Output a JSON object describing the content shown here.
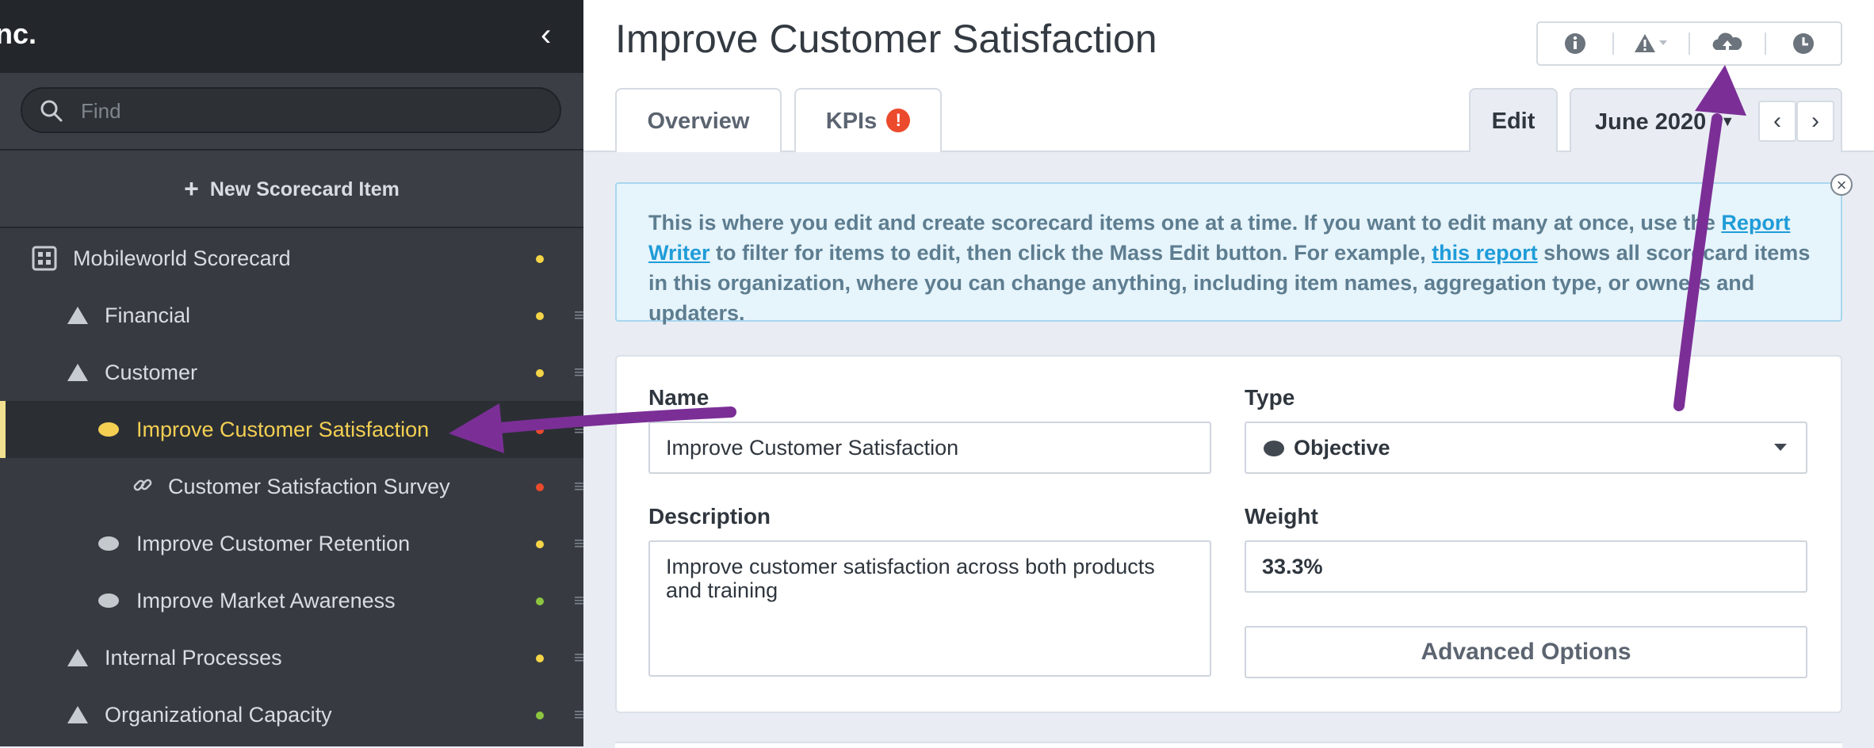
{
  "sidebar": {
    "org_title": "nc.",
    "search_placeholder": "Find",
    "new_item_label": "New Scorecard Item",
    "items": [
      {
        "label": "Mobileworld Scorecard",
        "icon": "scorecard-icon",
        "status_color": "#f5d547"
      },
      {
        "label": "Financial",
        "icon": "triangle-icon",
        "status_color": "#f5d547"
      },
      {
        "label": "Customer",
        "icon": "triangle-icon",
        "status_color": "#f5d547"
      },
      {
        "label": "Improve Customer Satisfaction",
        "icon": "objective-icon",
        "status_color": "#ec4a2c",
        "active": true
      },
      {
        "label": "Customer Satisfaction Survey",
        "icon": "link-icon",
        "status_color": "#ec4a2c"
      },
      {
        "label": "Improve Customer Retention",
        "icon": "objective-icon",
        "status_color": "#f5d547"
      },
      {
        "label": "Improve Market Awareness",
        "icon": "objective-icon",
        "status_color": "#8cc63f"
      },
      {
        "label": "Internal Processes",
        "icon": "triangle-icon",
        "status_color": "#f5d547"
      },
      {
        "label": "Organizational Capacity",
        "icon": "triangle-icon",
        "status_color": "#8cc63f"
      }
    ]
  },
  "header": {
    "title": "Improve Customer Satisfaction",
    "icons": [
      "info-icon",
      "warning-icon",
      "cloud-upload-icon",
      "clock-icon"
    ]
  },
  "tabs": {
    "overview": "Overview",
    "kpis": "KPIs",
    "kpis_alert": "!",
    "edit": "Edit",
    "period": "June 2020"
  },
  "info": {
    "text_1": "This is where you edit and create scorecard items one at a time. If you want to edit many at once, use the ",
    "link_1": "Report Writer",
    "text_2": " to filter for items to edit, then click the Mass Edit button. For example, ",
    "link_2": "this report",
    "text_3": " shows all scorecard items in this organization, where you can change anything, including item names, aggregation type, or owners and updaters."
  },
  "form": {
    "name_label": "Name",
    "name_value": "Improve Customer Satisfaction",
    "type_label": "Type",
    "type_value": "Objective",
    "description_label": "Description",
    "description_value": "Improve customer satisfaction across both products and training",
    "weight_label": "Weight",
    "weight_value": "33.3%",
    "advanced_button": "Advanced Options"
  },
  "colors": {
    "sidebar_bg": "#373b41",
    "active_text": "#f4cf52",
    "annotation_arrow": "#7b2f96",
    "link": "#1f9cd8"
  }
}
